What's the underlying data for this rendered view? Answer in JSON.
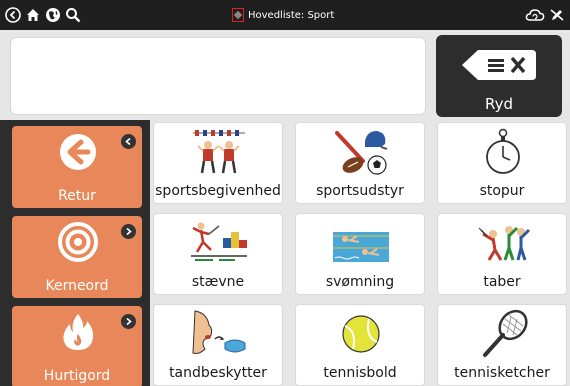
{
  "statusbar": {
    "title": "Hovedliste: Sport",
    "left_icons": [
      "back-icon",
      "home-icon",
      "globe-icon",
      "search-icon"
    ],
    "right_icons": [
      "cloud-sync-icon",
      "edit-disabled-icon"
    ]
  },
  "message_bar": {
    "text": "",
    "clear_label": "Ryd"
  },
  "categories": [
    {
      "label": "Retur",
      "icon": "back-arrow-icon"
    },
    {
      "label": "Kerneord",
      "icon": "target-icon"
    },
    {
      "label": "Hurtigord",
      "icon": "flame-icon"
    }
  ],
  "grid": [
    {
      "label": "sportsbegivenhed"
    },
    {
      "label": "sportsudstyr"
    },
    {
      "label": "stopur"
    },
    {
      "label": "stævne"
    },
    {
      "label": "svømning"
    },
    {
      "label": "taber"
    },
    {
      "label": "tandbeskytter"
    },
    {
      "label": "tennisbold"
    },
    {
      "label": "tennisketcher"
    }
  ],
  "colors": {
    "accent": "#e8875a",
    "bar": "#1f1f1f",
    "panel": "#2d2d2d",
    "tennis_ball": "#e3e33a"
  }
}
